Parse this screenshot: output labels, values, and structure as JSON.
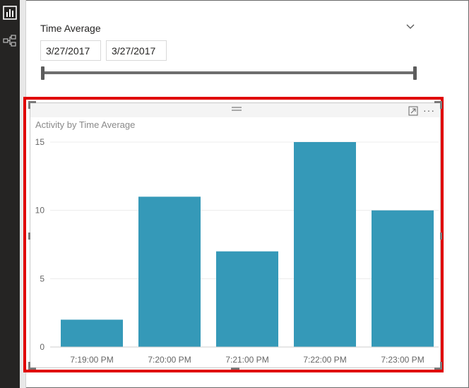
{
  "nav": {
    "items": [
      {
        "name": "report-view-icon"
      },
      {
        "name": "model-view-icon"
      }
    ]
  },
  "slicer": {
    "title": "Time Average",
    "start_date": "3/27/2017",
    "end_date": "3/27/2017",
    "range_start_fraction": 0,
    "range_end_fraction": 1
  },
  "visual": {
    "more_options": "···"
  },
  "colors": {
    "bar": "#3599b8",
    "selection": "#e00000",
    "rail": "#252423"
  },
  "chart_data": {
    "type": "bar",
    "title": "Activity by Time Average",
    "categories": [
      "7:19:00 PM",
      "7:20:00 PM",
      "7:21:00 PM",
      "7:22:00 PM",
      "7:23:00 PM"
    ],
    "values": [
      2,
      11,
      7,
      15,
      10
    ],
    "yticks": [
      0,
      5,
      10,
      15
    ],
    "ylim": [
      0,
      15
    ],
    "xlabel": "",
    "ylabel": "",
    "grid": true,
    "legend": "none"
  }
}
